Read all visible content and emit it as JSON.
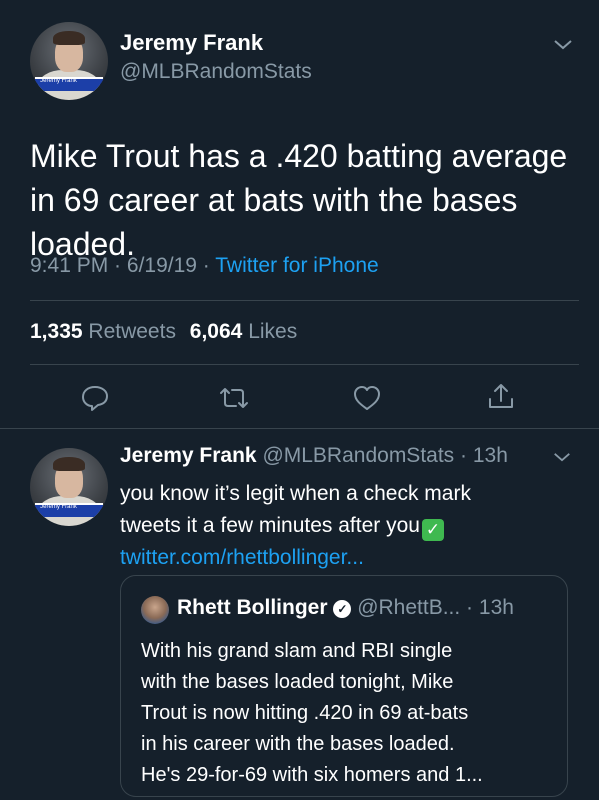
{
  "tweet": {
    "author_name": "Jeremy Frank",
    "author_handle": "@MLBRandomStats",
    "avatar_banner": "Jeremy Frank",
    "text": "Mike Trout has a .420 batting average in 69 career at bats with the bases loaded.",
    "time": "9:41 PM",
    "date": "6/19/19",
    "source": "Twitter for iPhone",
    "retweets_count": "1,335",
    "retweets_label": "Retweets",
    "likes_count": "6,064",
    "likes_label": "Likes"
  },
  "reply": {
    "author_name": "Jeremy Frank",
    "author_handle": "@MLBRandomStats",
    "time_ago": "13h",
    "avatar_banner": "Jeremy Frank",
    "text_line1": "you know it’s legit when a check mark",
    "text_line2": "tweets it a few minutes after you",
    "emoji": "✓",
    "link": "twitter.com/rhettbollinger...",
    "quote": {
      "author_name": "Rhett Bollinger",
      "author_handle": "@RhettB...",
      "time_ago": "13h",
      "lines": [
        "With his grand slam and RBI single",
        "with the bases loaded tonight, Mike",
        "Trout is now hitting .420 in 69 at-bats",
        "in his career with the bases loaded.",
        "He's 29-for-69 with six homers and 1..."
      ]
    }
  },
  "icons": {
    "dropdown": "chevron-down-icon",
    "reply": "reply-icon",
    "retweet": "retweet-icon",
    "like": "heart-icon",
    "share": "share-icon"
  },
  "colors": {
    "background": "#15202b",
    "link": "#1da1f2",
    "muted": "#8899a6",
    "divider": "#38444d",
    "check": "#3fb950"
  }
}
